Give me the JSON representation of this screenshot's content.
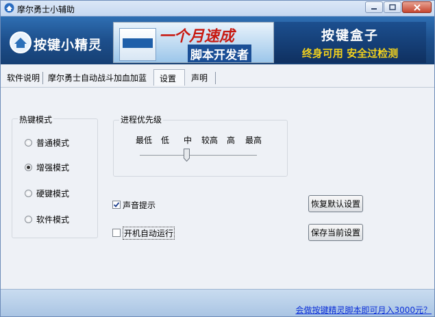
{
  "window": {
    "title": "摩尔勇士小辅助"
  },
  "header": {
    "logo_text": "按键小精灵",
    "ad_left": {
      "line1": "一个月速成",
      "line2": "脚本开发者"
    },
    "ad_right": {
      "line1": "按键盒子",
      "line2": "终身可用  安全过检测"
    }
  },
  "tabs": [
    {
      "label": "软件说明"
    },
    {
      "label": "摩尔勇士自动战斗加血加蓝"
    },
    {
      "label": "设置"
    },
    {
      "label": "声明"
    }
  ],
  "hotkey_mode": {
    "label": "热键模式",
    "options": [
      {
        "label": "普通模式",
        "checked": false
      },
      {
        "label": "增强模式",
        "checked": true
      },
      {
        "label": "硬键模式",
        "checked": false
      },
      {
        "label": "软件模式",
        "checked": false
      }
    ]
  },
  "priority": {
    "label": "进程优先级",
    "ticks": [
      "最低",
      "低",
      "中",
      "较高",
      "高",
      "最高"
    ],
    "selected": "中"
  },
  "options": {
    "sound_label": "声音提示",
    "sound_checked": true,
    "autostart_label": "开机自动运行",
    "autostart_checked": false
  },
  "buttons": {
    "restore_default": "恢复默认设置",
    "save_current": "保存当前设置"
  },
  "footer": {
    "link": "会做按键精灵脚本即可月入3000元？"
  }
}
